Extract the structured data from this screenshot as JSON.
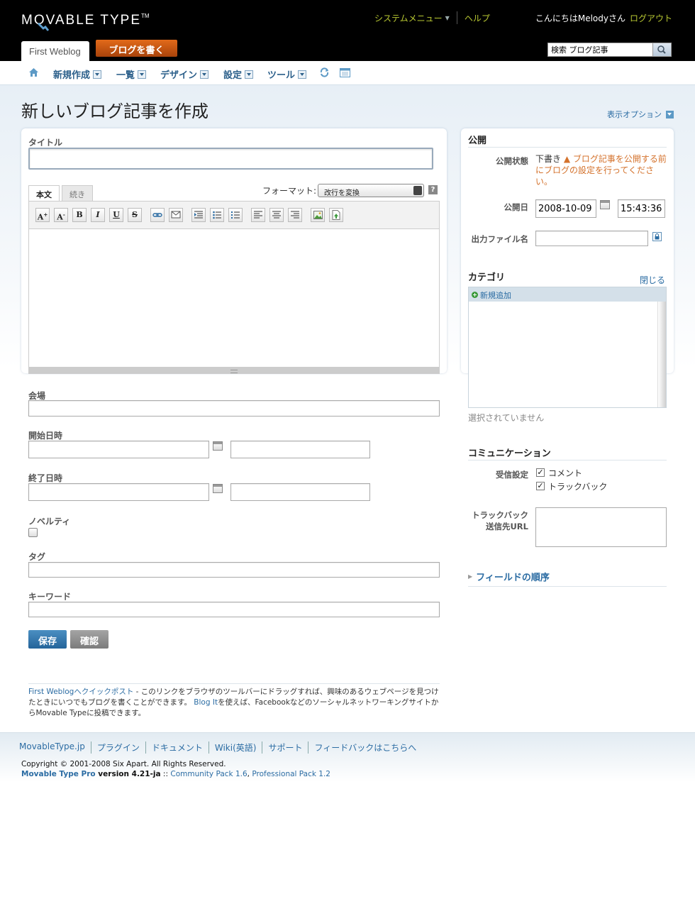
{
  "header": {
    "logo": "MOVABLE TYPE",
    "logo_tm": "TM",
    "system_menu": "システムメニュー",
    "help": "ヘルプ",
    "greeting": "こんにちはMelodyさん",
    "logout": "ログアウト",
    "blog_tab": "First Weblog",
    "write_button": "ブログを書く",
    "search_value": "検索 ブログ記事"
  },
  "nav": {
    "items": [
      "新規作成",
      "一覧",
      "デザイン",
      "設定",
      "ツール"
    ]
  },
  "page": {
    "title": "新しいブログ記事を作成",
    "display_options": "表示オプション"
  },
  "form": {
    "title_label": "タイトル",
    "tab_body": "本文",
    "tab_more": "続き",
    "format_label": "フォーマット:",
    "format_value": "改行を変換",
    "help_q": "?",
    "toolbar_icons": [
      "font-larger-icon",
      "font-smaller-icon",
      "bold-icon",
      "italic-icon",
      "underline-icon",
      "strikethrough-icon",
      "link-icon",
      "email-icon",
      "indent-icon",
      "bulleted-list-icon",
      "numbered-list-icon",
      "align-left-icon",
      "align-center-icon",
      "align-right-icon",
      "insert-image-icon",
      "insert-file-icon"
    ],
    "venue_label": "会場",
    "start_label": "開始日時",
    "end_label": "終了日時",
    "novelty_label": "ノベルティ",
    "tags_label": "タグ",
    "keywords_label": "キーワード",
    "save_button": "保存",
    "preview_button": "確認"
  },
  "quickpost": {
    "link": "First Weblogへクイックポスト",
    "text1": " - このリンクをブラウザのツールバーにドラッグすれば、興味のあるウェブページを見つけたときにいつでもブログを書くことができます。",
    "blogit": "Blog It",
    "text2": "を使えば、FacebookなどのソーシャルネットワーキングサイトからMovable Typeに投稿できます。"
  },
  "sidebar": {
    "publish_heading": "公開",
    "status_label": "公開状態",
    "status_value": "下書き",
    "status_warning": "ブログ記事を公開する前にブログの設定を行ってください。",
    "date_label": "公開日",
    "date_value": "2008-10-09",
    "time_value": "15:43:36",
    "basename_label": "出力ファイル名",
    "category_heading": "カテゴリ",
    "category_close": "閉じる",
    "category_add": "新規追加",
    "category_none": "選択されていません",
    "comm_heading": "コミュニケーション",
    "accept_label": "受信設定",
    "comments": "コメント",
    "trackbacks": "トラックバック",
    "tb_label_1": "トラックバック",
    "tb_label_2": "送信先URL",
    "field_order": "フィールドの順序"
  },
  "footer": {
    "links": [
      "MovableType.jp",
      "プラグイン",
      "ドキュメント",
      "Wiki(英語)",
      "サポート",
      "フィードバックはこちらへ"
    ],
    "copyright": "Copyright © 2001-2008 Six Apart. All Rights Reserved.",
    "product": "Movable Type Pro",
    "version": " version 4.21-ja",
    "sep": " :: ",
    "pack1": "Community Pack 1.6",
    "comma": ", ",
    "pack2": "Professional Pack 1.2"
  },
  "colors": {
    "header_bg": "#000000",
    "link": "#2b6ca3",
    "accent_yellow": "#b8c832",
    "write_button": "#c9561a",
    "save_button": "#2f75ad"
  }
}
